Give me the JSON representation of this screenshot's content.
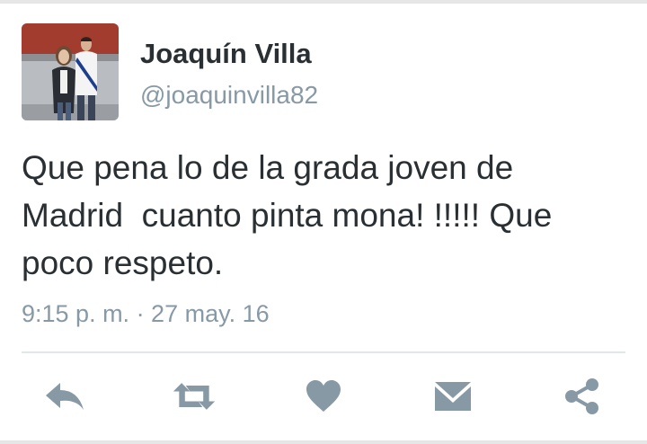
{
  "user": {
    "display_name": "Joaquín Villa",
    "handle": "@joaquinvilla82"
  },
  "tweet": {
    "text": "Que pena lo de la grada joven de\nMadrid  cuanto pinta mona! !!!!! Que\npoco respeto.",
    "timestamp": "9:15 p. m. · 27 may. 16"
  },
  "actions": [
    {
      "name": "reply",
      "icon": "reply-arrow-icon"
    },
    {
      "name": "retweet",
      "icon": "retweet-icon"
    },
    {
      "name": "like",
      "icon": "heart-icon"
    },
    {
      "name": "direct-message",
      "icon": "envelope-icon"
    },
    {
      "name": "share",
      "icon": "share-icon"
    }
  ],
  "colors": {
    "text": "#292f33",
    "secondary": "#8899a6",
    "icon": "#8899a6",
    "divider": "#e1e8ed"
  }
}
